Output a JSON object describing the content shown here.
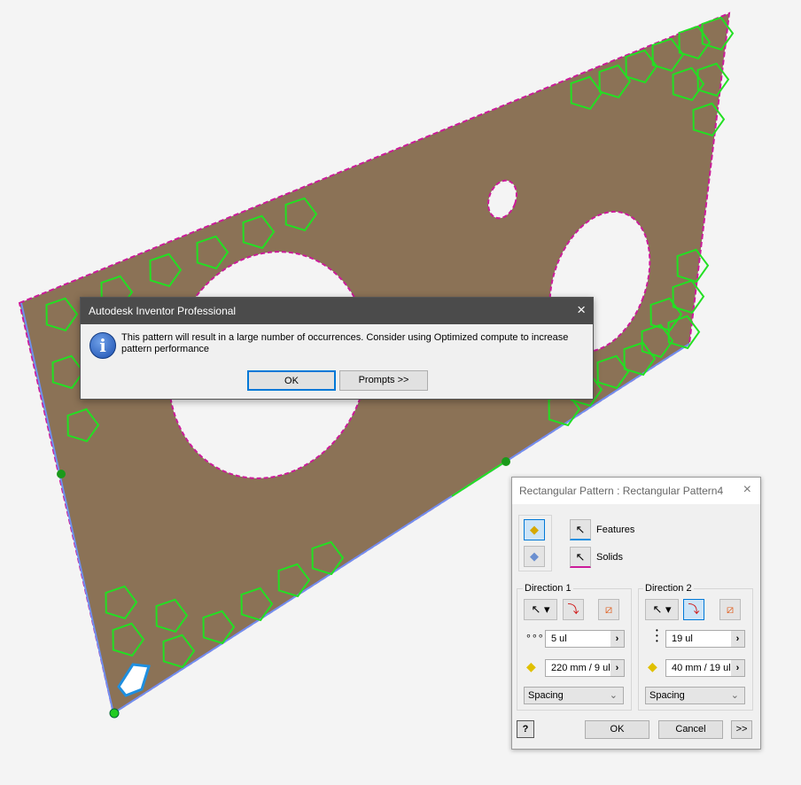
{
  "message_dialog": {
    "title": "Autodesk Inventor Professional",
    "close_icon": "×",
    "info_icon": "i",
    "text": "This pattern will result in a large number of occurrences. Consider using Optimized compute to increase pattern performance",
    "ok_label": "OK",
    "prompts_label": "Prompts >>"
  },
  "pattern_dialog": {
    "title": "Rectangular Pattern : Rectangular Pattern4",
    "close_icon": "×",
    "features_label": "Features",
    "solids_label": "Solids",
    "direction1": {
      "label": "Direction 1",
      "count": "5 ul",
      "spacing": "220 mm / 9 ul",
      "method": "Spacing"
    },
    "direction2": {
      "label": "Direction 2",
      "count": "19 ul",
      "spacing": "40 mm / 19 ul",
      "method": "Spacing"
    },
    "ok_label": "OK",
    "cancel_label": "Cancel",
    "more_label": ">>",
    "help_icon": "?"
  },
  "colors": {
    "plate": "#8b7256",
    "pattern_outline": "#22e022",
    "edge": "#cc1a9a",
    "accent": "#0078d7"
  }
}
